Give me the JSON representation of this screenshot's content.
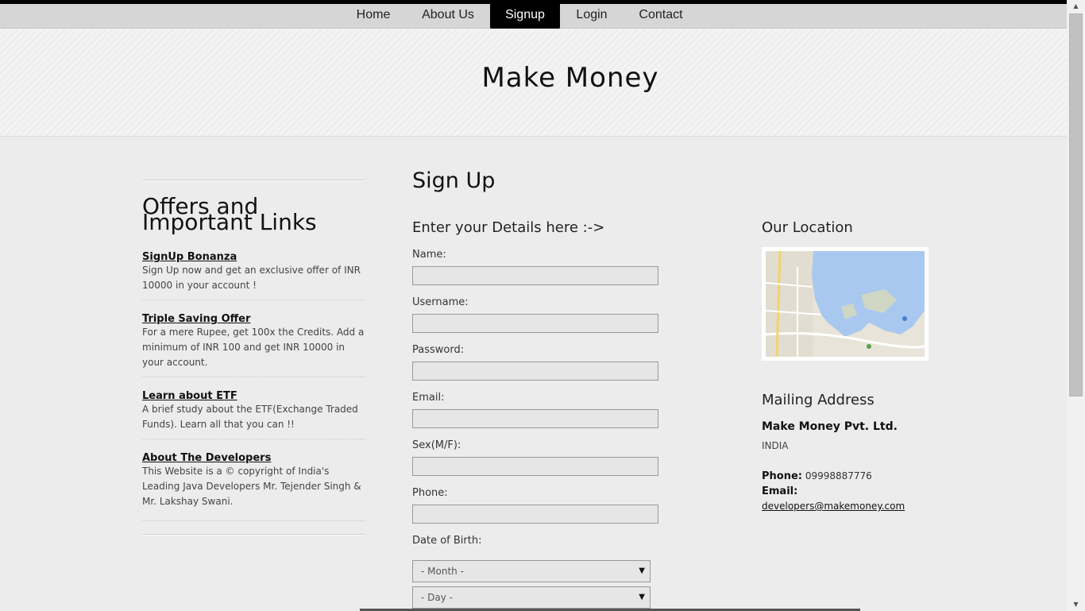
{
  "nav": {
    "items": [
      {
        "label": "Home"
      },
      {
        "label": "About Us"
      },
      {
        "label": "Signup"
      },
      {
        "label": "Login"
      },
      {
        "label": "Contact"
      }
    ],
    "active": "Signup"
  },
  "header": {
    "title": "Make Money"
  },
  "offers": {
    "title": "Offers and Important Links",
    "items": [
      {
        "link": "SignUp Bonanza",
        "text": "Sign Up now and get an exclusive offer of INR 10000 in your account !"
      },
      {
        "link": "Triple Saving Offer",
        "text": "For a mere Rupee, get 100x the Credits. Add a minimum of INR 100 and get INR 10000 in your account."
      },
      {
        "link": "Learn about ETF",
        "text": "A brief study about the ETF(Exchange Traded Funds). Learn all that you can !!"
      },
      {
        "link": "About The Developers",
        "text": "This Website is a © copyright of India's Leading Java Developers Mr. Tejender Singh & Mr. Lakshay Swani."
      }
    ]
  },
  "signup": {
    "title": "Sign Up",
    "subtitle": "Enter your Details here :->",
    "fields": [
      {
        "label": "Name:",
        "value": ""
      },
      {
        "label": "Username:",
        "value": ""
      },
      {
        "label": "Password:",
        "value": ""
      },
      {
        "label": "Email:",
        "value": ""
      },
      {
        "label": "Sex(M/F):",
        "value": ""
      },
      {
        "label": "Phone:",
        "value": ""
      }
    ],
    "dob_label": "Date of Birth:",
    "month_placeholder": "- Month -",
    "day_placeholder": "- Day -"
  },
  "location": {
    "title": "Our Location",
    "map_icon": "map-thumbnail"
  },
  "mailing": {
    "title": "Mailing Address",
    "company": "Make Money Pvt. Ltd.",
    "country": "INDIA",
    "phone_label": "Phone:",
    "phone": "09998887776",
    "email_label": "Email:",
    "email": "developers@makemoney.com"
  },
  "colors": {
    "nav_bg": "#d6d6d6",
    "active_tab": "#000000",
    "page_bg": "#ececec",
    "map_water": "#a9c8f0"
  }
}
